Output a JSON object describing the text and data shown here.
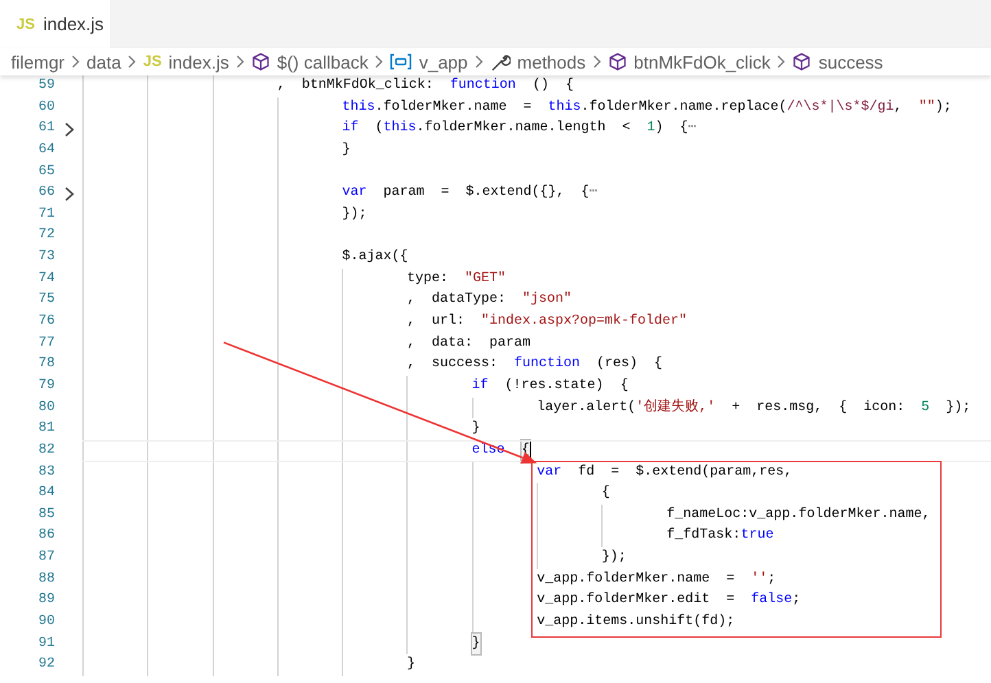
{
  "tab": {
    "badge": "JS",
    "label": "index.js",
    "selected": true
  },
  "breadcrumbs": [
    {
      "kind": "folder",
      "label": "filemgr"
    },
    {
      "kind": "folder",
      "label": "data"
    },
    {
      "kind": "file",
      "badge": "JS",
      "label": "index.js"
    },
    {
      "kind": "method",
      "label": "$() callback"
    },
    {
      "kind": "variable",
      "label": "v_app"
    },
    {
      "kind": "property",
      "label": "methods"
    },
    {
      "kind": "method",
      "label": "btnMkFdOk_click"
    },
    {
      "kind": "method",
      "label": "success"
    }
  ],
  "lines": [
    {
      "number": "59",
      "folded": false,
      "current": false,
      "boxed": false,
      "tokens": [
        {
          "kind": "plain",
          "text": "\t\t\t,  btnMkFdOk_click:  "
        },
        {
          "kind": "kw",
          "text": "function"
        },
        {
          "kind": "plain",
          "text": "  ()  {"
        }
      ]
    },
    {
      "number": "60",
      "folded": false,
      "current": false,
      "boxed": false,
      "tokens": [
        {
          "kind": "kw",
          "text": "\t\t\t\tthis"
        },
        {
          "kind": "plain",
          "text": ".folderMker.name  =  "
        },
        {
          "kind": "kw",
          "text": "this"
        },
        {
          "kind": "plain",
          "text": ".folderMker.name.replace("
        },
        {
          "kind": "regex",
          "text": "/^\\s*|\\s*$/gi"
        },
        {
          "kind": "plain",
          "text": ",  "
        },
        {
          "kind": "str",
          "text": "\"\""
        },
        {
          "kind": "plain",
          "text": ");"
        }
      ]
    },
    {
      "number": "61",
      "folded": true,
      "current": false,
      "boxed": false,
      "tokens": [
        {
          "kind": "kw",
          "text": "\t\t\t\tif"
        },
        {
          "kind": "plain",
          "text": "  ("
        },
        {
          "kind": "kw",
          "text": "this"
        },
        {
          "kind": "plain",
          "text": ".folderMker.name.length  <  "
        },
        {
          "kind": "num",
          "text": "1"
        },
        {
          "kind": "plain",
          "text": ")  {"
        },
        {
          "kind": "fold",
          "text": "⋯"
        }
      ]
    },
    {
      "number": "64",
      "folded": false,
      "current": false,
      "boxed": false,
      "tokens": [
        {
          "kind": "plain",
          "text": "\t\t\t\t}"
        }
      ]
    },
    {
      "number": "65",
      "folded": false,
      "current": false,
      "boxed": false
    },
    {
      "number": "66",
      "folded": true,
      "current": false,
      "boxed": false,
      "tokens": [
        {
          "kind": "kw",
          "text": "\t\t\t\tvar"
        },
        {
          "kind": "plain",
          "text": "  param  =  $.extend({},  {"
        },
        {
          "kind": "fold",
          "text": "⋯"
        }
      ]
    },
    {
      "number": "71",
      "folded": false,
      "current": false,
      "boxed": false,
      "tokens": [
        {
          "kind": "plain",
          "text": "\t\t\t\t});"
        }
      ]
    },
    {
      "number": "72",
      "folded": false,
      "current": false,
      "boxed": false
    },
    {
      "number": "73",
      "folded": false,
      "current": false,
      "boxed": false,
      "tokens": [
        {
          "kind": "plain",
          "text": "\t\t\t\t$.ajax({"
        }
      ]
    },
    {
      "number": "74",
      "folded": false,
      "current": false,
      "boxed": false,
      "tokens": [
        {
          "kind": "plain",
          "text": "\t\t\t\t\ttype:  "
        },
        {
          "kind": "str",
          "text": "\"GET\""
        }
      ]
    },
    {
      "number": "75",
      "folded": false,
      "current": false,
      "boxed": false,
      "tokens": [
        {
          "kind": "plain",
          "text": "\t\t\t\t\t,  dataType:  "
        },
        {
          "kind": "str",
          "text": "\"json\""
        }
      ]
    },
    {
      "number": "76",
      "folded": false,
      "current": false,
      "boxed": false,
      "tokens": [
        {
          "kind": "plain",
          "text": "\t\t\t\t\t,  url:  "
        },
        {
          "kind": "str",
          "text": "\"index.aspx?op=mk-folder\""
        }
      ]
    },
    {
      "number": "77",
      "folded": false,
      "current": false,
      "boxed": false,
      "tokens": [
        {
          "kind": "plain",
          "text": "\t\t\t\t\t,  data:  param"
        }
      ]
    },
    {
      "number": "78",
      "folded": false,
      "current": false,
      "boxed": false,
      "tokens": [
        {
          "kind": "plain",
          "text": "\t\t\t\t\t,  success:  "
        },
        {
          "kind": "kw",
          "text": "function"
        },
        {
          "kind": "plain",
          "text": "  (res)  {"
        }
      ]
    },
    {
      "number": "79",
      "folded": false,
      "current": false,
      "boxed": false,
      "tokens": [
        {
          "kind": "kw",
          "text": "\t\t\t\t\t\tif"
        },
        {
          "kind": "plain",
          "text": "  (!res.state)  {"
        }
      ]
    },
    {
      "number": "80",
      "folded": false,
      "current": false,
      "boxed": false,
      "tokens": [
        {
          "kind": "plain",
          "text": "\t\t\t\t\t\t\tlayer.alert("
        },
        {
          "kind": "str",
          "text": "'创建失败,'"
        },
        {
          "kind": "plain",
          "text": "  +  res.msg,  {  icon:  "
        },
        {
          "kind": "num",
          "text": "5"
        },
        {
          "kind": "plain",
          "text": "  });"
        }
      ]
    },
    {
      "number": "81",
      "folded": false,
      "current": false,
      "boxed": false,
      "tokens": [
        {
          "kind": "plain",
          "text": "\t\t\t\t\t\t}"
        }
      ]
    },
    {
      "number": "82",
      "folded": false,
      "current": true,
      "boxed": false,
      "tokens": [
        {
          "kind": "kw",
          "text": "\t\t\t\t\t\telse"
        },
        {
          "kind": "bracket",
          "text": "  {"
        }
      ]
    },
    {
      "number": "83",
      "folded": false,
      "current": false,
      "boxed": true,
      "tokens": [
        {
          "kind": "kw",
          "text": "\t\t\t\t\t\t\tvar"
        },
        {
          "kind": "plain",
          "text": "  fd  =  $.extend(param,res,"
        }
      ]
    },
    {
      "number": "84",
      "folded": false,
      "current": false,
      "boxed": true,
      "tokens": [
        {
          "kind": "plain",
          "text": "\t\t\t\t\t\t\t\t{"
        }
      ]
    },
    {
      "number": "85",
      "folded": false,
      "current": false,
      "boxed": true,
      "tokens": [
        {
          "kind": "plain",
          "text": "\t\t\t\t\t\t\t\t\tf_nameLoc:v_app.folderMker.name,"
        }
      ]
    },
    {
      "number": "86",
      "folded": false,
      "current": false,
      "boxed": true,
      "tokens": [
        {
          "kind": "plain",
          "text": "\t\t\t\t\t\t\t\t\tf_fdTask:"
        },
        {
          "kind": "kw",
          "text": "true"
        }
      ]
    },
    {
      "number": "87",
      "folded": false,
      "current": false,
      "boxed": true,
      "tokens": [
        {
          "kind": "plain",
          "text": "\t\t\t\t\t\t\t\t});"
        }
      ]
    },
    {
      "number": "88",
      "folded": false,
      "current": false,
      "boxed": true,
      "tokens": [
        {
          "kind": "plain",
          "text": "\t\t\t\t\t\t\tv_app.folderMker.name  =  "
        },
        {
          "kind": "str",
          "text": "''"
        },
        {
          "kind": "plain",
          "text": ";"
        }
      ]
    },
    {
      "number": "89",
      "folded": false,
      "current": false,
      "boxed": true,
      "tokens": [
        {
          "kind": "plain",
          "text": "\t\t\t\t\t\t\tv_app.folderMker.edit  =  "
        },
        {
          "kind": "kw",
          "text": "false"
        },
        {
          "kind": "plain",
          "text": ";"
        }
      ]
    },
    {
      "number": "90",
      "folded": false,
      "current": false,
      "boxed": true,
      "tokens": [
        {
          "kind": "plain",
          "text": "\t\t\t\t\t\t\tv_app.items.unshift(fd);"
        }
      ]
    },
    {
      "number": "91",
      "folded": false,
      "current": false,
      "boxed": false,
      "tokens": [
        {
          "kind": "bracket",
          "text": "\t\t\t\t\t\t}"
        }
      ]
    },
    {
      "number": "92",
      "folded": false,
      "current": false,
      "boxed": false,
      "tokens": [
        {
          "kind": "plain",
          "text": "\t\t\t\t\t}"
        }
      ]
    }
  ]
}
